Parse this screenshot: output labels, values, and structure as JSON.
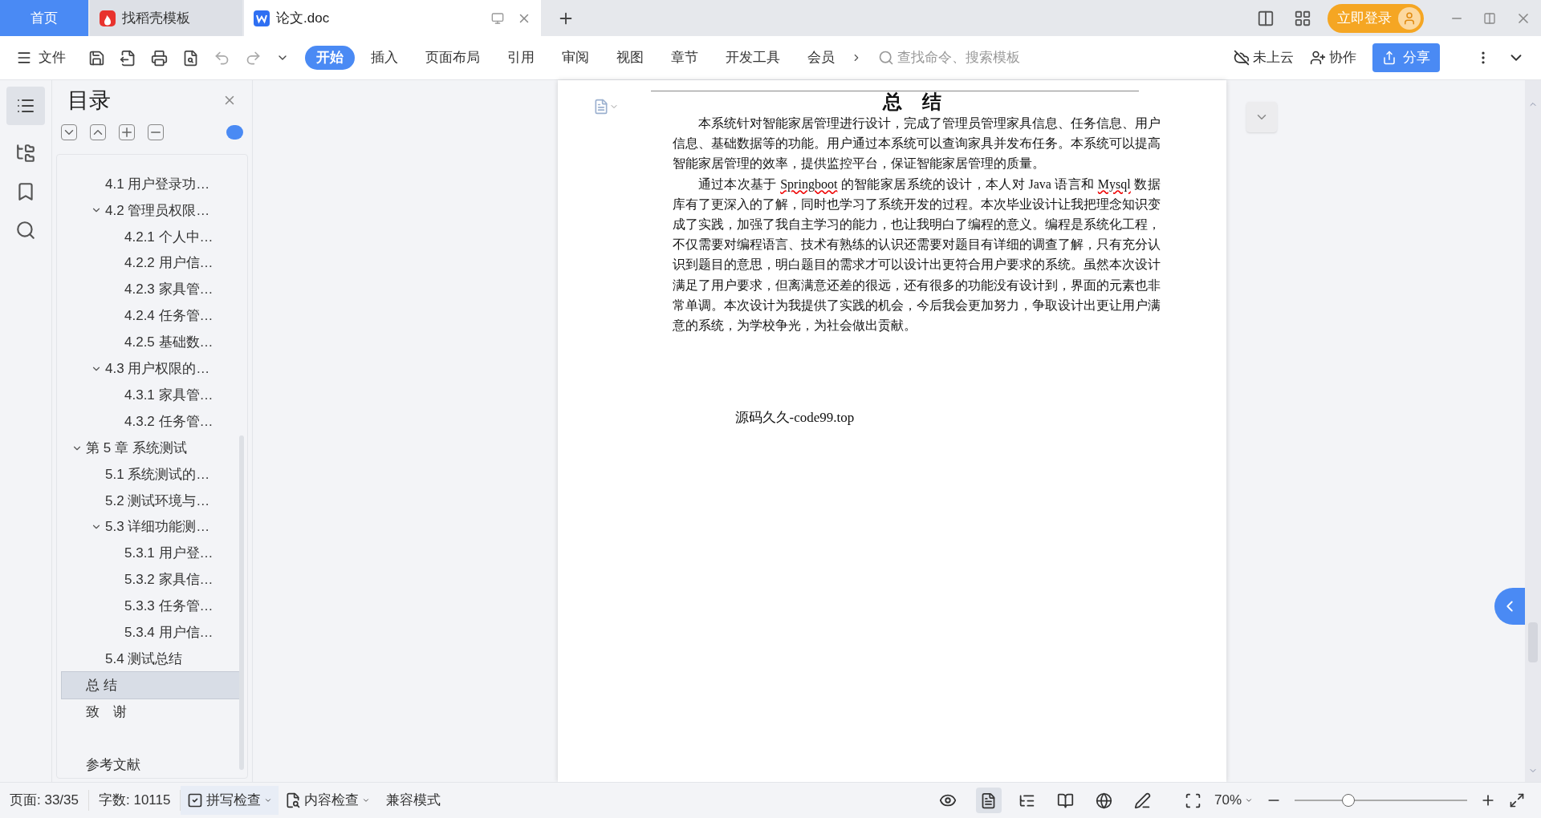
{
  "tabs": [
    {
      "label": "首页",
      "kind": "home",
      "selected": false
    },
    {
      "label": "找稻壳模板",
      "kind": "docer",
      "selected": false
    },
    {
      "label": "论文.doc",
      "kind": "doc",
      "selected": true
    }
  ],
  "login_button": "立即登录",
  "file_menu": "文件",
  "ribbon_tabs": [
    {
      "label": "开始",
      "selected": true
    },
    {
      "label": "插入",
      "selected": false
    },
    {
      "label": "页面布局",
      "selected": false
    },
    {
      "label": "引用",
      "selected": false
    },
    {
      "label": "审阅",
      "selected": false
    },
    {
      "label": "视图",
      "selected": false
    },
    {
      "label": "章节",
      "selected": false
    },
    {
      "label": "开发工具",
      "selected": false
    },
    {
      "label": "会员",
      "selected": false
    }
  ],
  "search": {
    "placeholder": "查找命令、搜索模板"
  },
  "cloud_status": "未上云",
  "collaborate": "协作",
  "share_button": "分享",
  "outline": {
    "title": "目录",
    "items": [
      {
        "kind": "group",
        "children": [
          {
            "kind": "entry",
            "label": "4.1 用户登录功…",
            "selected": false
          },
          {
            "kind": "entry",
            "label": "4.2 管理员权限…",
            "expanded": true,
            "selected": false,
            "children": [
              {
                "kind": "entry",
                "label": "4.2.1 个人中…",
                "selected": false
              },
              {
                "kind": "entry",
                "label": "4.2.2 用户信…",
                "selected": false
              },
              {
                "kind": "entry",
                "label": "4.2.3 家具管…",
                "selected": false
              },
              {
                "kind": "entry",
                "label": "4.2.4 任务管…",
                "selected": false
              },
              {
                "kind": "entry",
                "label": "4.2.5 基础数…",
                "selected": false
              }
            ]
          },
          {
            "kind": "entry",
            "label": "4.3 用户权限的…",
            "expanded": true,
            "selected": false,
            "children": [
              {
                "kind": "entry",
                "label": "4.3.1 家具管…",
                "selected": false
              },
              {
                "kind": "entry",
                "label": "4.3.2 任务管…",
                "selected": false
              }
            ]
          }
        ]
      },
      {
        "kind": "entry",
        "label": "第 5 章  系统测试",
        "expanded": true,
        "selected": false,
        "children": [
          {
            "kind": "entry",
            "label": "5.1 系统测试的…",
            "selected": false
          },
          {
            "kind": "entry",
            "label": "5.2 测试环境与…",
            "selected": false
          },
          {
            "kind": "entry",
            "label": "5.3 详细功能测…",
            "expanded": true,
            "selected": false,
            "children": [
              {
                "kind": "entry",
                "label": "5.3.1 用户登…",
                "selected": false
              },
              {
                "kind": "entry",
                "label": "5.3.2 家具信…",
                "selected": false
              },
              {
                "kind": "entry",
                "label": "5.3.3 任务管…",
                "selected": false
              },
              {
                "kind": "entry",
                "label": "5.3.4 用户信…",
                "selected": false
              }
            ]
          },
          {
            "kind": "entry",
            "label": "5.4 测试总结",
            "selected": false
          }
        ]
      },
      {
        "kind": "entry",
        "label": "总 结",
        "selected": true
      },
      {
        "kind": "entry",
        "label": "致　谢",
        "selected": false
      },
      {
        "kind": "blank"
      },
      {
        "kind": "entry",
        "label": "参考文献",
        "selected": false
      }
    ]
  },
  "document": {
    "heading": "总 结",
    "paragraphs": [
      [
        {
          "text": "本系统针对智能家居管理进行设计，完成了管理员管理家具信息、任务信息、用户信息、基础数据等的功能。用户通过本系统可以查询家具并发布任务。本系统可以提高智能家居管理的效率，提供监控平台，保证智能家居管理的质量。",
          "misspelled": false
        }
      ],
      [
        {
          "text": "通过本次基于 ",
          "misspelled": false
        },
        {
          "text": "Springboot",
          "misspelled": true
        },
        {
          "text": " 的智能家居系统的设计，本人对 Java 语言和 ",
          "misspelled": false
        },
        {
          "text": "Mysql",
          "misspelled": true
        },
        {
          "text": " 数据库有了更深入的了解，同时也学习了系统开发的过程。本次毕业设计让我把理念知识变成了实践，加强了我自主学习的能力，也让我明白了编程的意义。编程是系统化工程，不仅需要对编程语言、技术有熟练的认识还需要对题目有详细的调查了解，只有充分认识到题目的意思，明白题目的需求才可以设计出更符合用户要求的系统。虽然本次设计满足了用户要求，但离满意还差的很远，还有很多的功能没有设计到，界面的元素也非常单调。本次设计为我提供了实践的机会，今后我会更加努力，争取设计出更让用户满意的系统，为学校争光，为社会做出贡献。",
          "misspelled": false
        }
      ]
    ],
    "footer_text": "源码久久-code99.top"
  },
  "status_bar": {
    "page": "页面: 33/35",
    "words": "字数: 10115",
    "spell_check": "拼写检查",
    "content_check": "内容检查",
    "compat_mode": "兼容模式",
    "views": [
      {
        "kind": "page",
        "selected": true
      },
      {
        "kind": "outline",
        "selected": false
      },
      {
        "kind": "read",
        "selected": false
      },
      {
        "kind": "web",
        "selected": false
      },
      {
        "kind": "pen",
        "selected": false
      }
    ],
    "zoom": "70%",
    "zoom_slider": {
      "level": 0.31
    }
  }
}
